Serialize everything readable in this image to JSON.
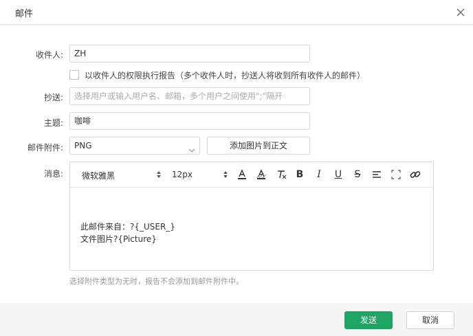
{
  "dialog": {
    "title": "邮件",
    "close_icon": "close-icon"
  },
  "form": {
    "recipient": {
      "label": "收件人:",
      "value": "ZH"
    },
    "permission_checkbox": {
      "label": "以收件人的权限执行报告（多个收件人时，抄送人将收到所有收件人的邮件）",
      "checked": false
    },
    "cc": {
      "label": "抄送:",
      "placeholder": "选择用户或输入用户名、邮箱，多个用户之间使用\";\"隔开",
      "value": ""
    },
    "subject": {
      "label": "主题:",
      "value": "咖啡"
    },
    "attachment": {
      "label": "邮件附件:",
      "value": "PNG",
      "add_image_label": "添加图片到正文"
    },
    "message": {
      "label": "消息:",
      "toolbar": {
        "font_family": "微软雅黑",
        "font_size": "12px",
        "tools": [
          "font-color-icon",
          "background-color-icon",
          "clear-format-icon",
          "bold-icon",
          "italic-icon",
          "underline-icon",
          "strikethrough-icon",
          "align-icon",
          "fullscreen-icon",
          "link-icon"
        ]
      },
      "lines": [
        "此邮件来自：?{_USER_}",
        "文件图片?{Picture}"
      ]
    },
    "hint": "选择附件类型为无时，报告不会添加到邮件附件中。"
  },
  "footer": {
    "send_label": "发送",
    "cancel_label": "取消"
  },
  "colors": {
    "primary": "#1fa463",
    "border": "#d9d9d9",
    "footer_bg": "#f5f5f5",
    "hint": "#999999"
  }
}
